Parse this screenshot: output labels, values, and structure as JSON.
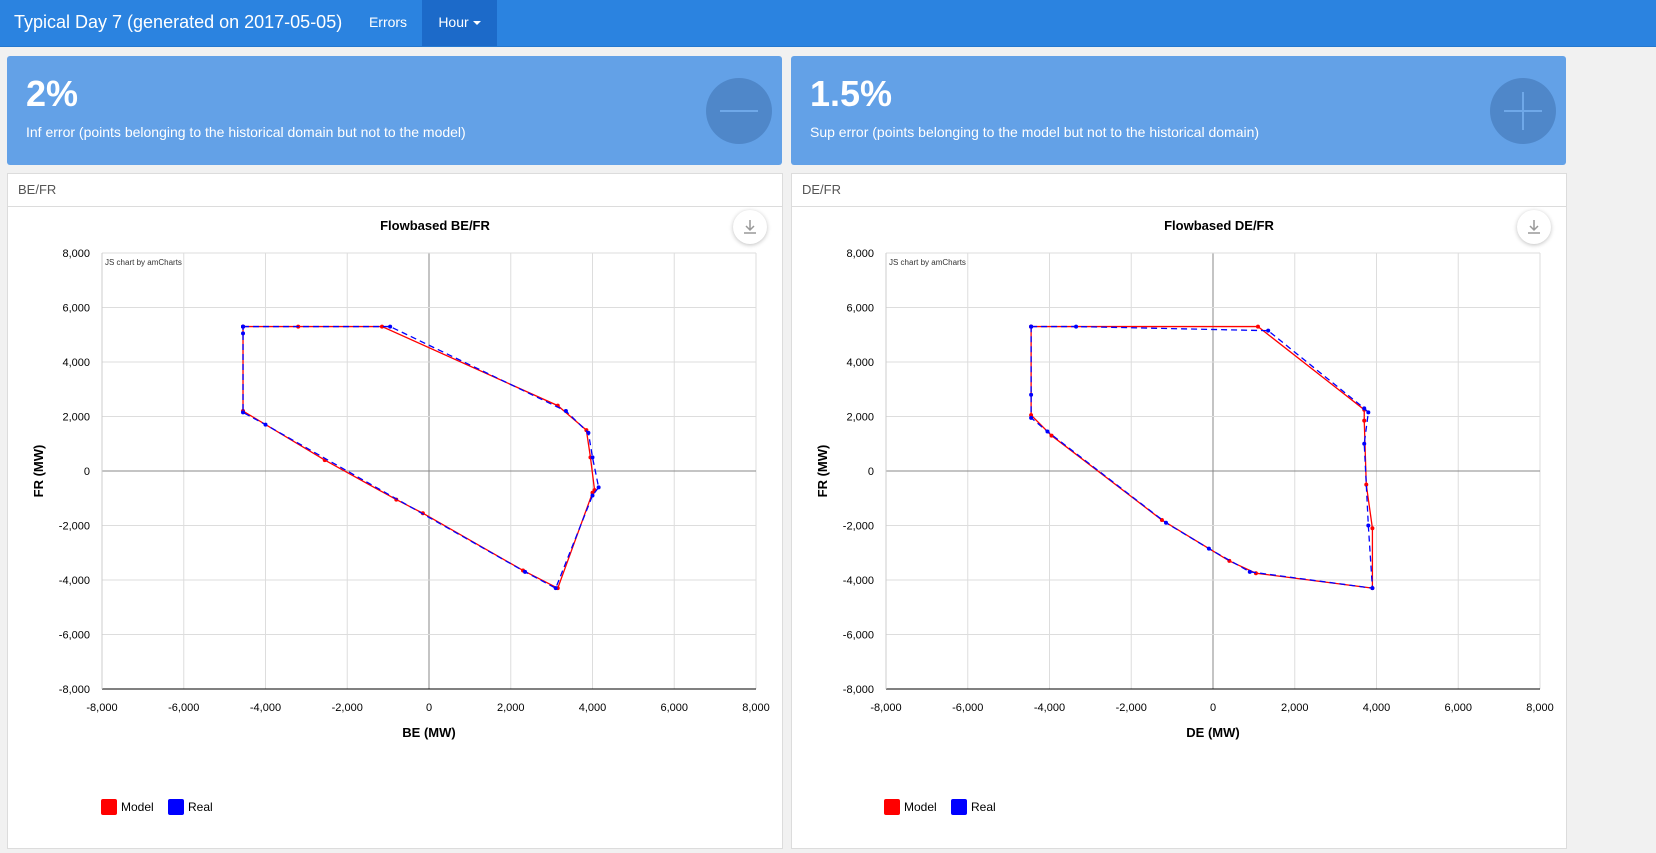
{
  "navbar": {
    "title": "Typical Day 7 (generated on 2017-05-05)",
    "errors_label": "Errors",
    "hour_label": "Hour"
  },
  "stats": [
    {
      "value": "2%",
      "label": "Inf error (points belonging to the historical domain but not to the model)",
      "icon": "minus-icon"
    },
    {
      "value": "1.5%",
      "label": "Sup error (points belonging to the model but not to the historical domain)",
      "icon": "plus-icon"
    }
  ],
  "colors": {
    "navbar": "#2b83e0",
    "stat_bg": "#63a1e7",
    "model": "#ff0000",
    "real": "#0000ff"
  },
  "panels": [
    {
      "heading": "BE/FR"
    },
    {
      "heading": "DE/FR"
    }
  ],
  "chart_data": [
    {
      "type": "scatter",
      "title": "Flowbased BE/FR",
      "credit": "JS chart by amCharts",
      "xlabel": "BE (MW)",
      "ylabel": "FR (MW)",
      "xlim": [
        -8000,
        8000
      ],
      "ylim": [
        -8000,
        8000
      ],
      "xticks": [
        "-8,000",
        "-6,000",
        "-4,000",
        "-2,000",
        "0",
        "2,000",
        "4,000",
        "6,000",
        "8,000"
      ],
      "yticks": [
        "8,000",
        "6,000",
        "4,000",
        "2,000",
        "0",
        "-2,000",
        "-4,000",
        "-6,000",
        "-8,000"
      ],
      "grid": true,
      "legend_position": "bottom-left",
      "series": [
        {
          "name": "Model",
          "color": "#ff0000",
          "dashed": false,
          "x": [
            -4550,
            -3200,
            -1150,
            3150,
            3850,
            3950,
            4050,
            4000,
            3150,
            2300,
            -150,
            -800,
            -2550,
            -4550,
            -4550
          ],
          "y": [
            5300,
            5300,
            5300,
            2400,
            1500,
            500,
            -700,
            -800,
            -4300,
            -3650,
            -1550,
            -1050,
            400,
            2200,
            5300
          ]
        },
        {
          "name": "Real",
          "color": "#0000ff",
          "dashed": true,
          "x": [
            -4550,
            -950,
            3350,
            3900,
            4000,
            4150,
            4000,
            3100,
            2350,
            -4000,
            -4550,
            -4550,
            -4550
          ],
          "y": [
            5300,
            5300,
            2200,
            1400,
            500,
            -600,
            -900,
            -4300,
            -3700,
            1700,
            2150,
            5050,
            5300
          ]
        }
      ]
    },
    {
      "type": "scatter",
      "title": "Flowbased DE/FR",
      "credit": "JS chart by amCharts",
      "xlabel": "DE (MW)",
      "ylabel": "FR (MW)",
      "xlim": [
        -8000,
        8000
      ],
      "ylim": [
        -8000,
        8000
      ],
      "xticks": [
        "-8,000",
        "-6,000",
        "-4,000",
        "-2,000",
        "0",
        "2,000",
        "4,000",
        "6,000",
        "8,000"
      ],
      "yticks": [
        "8,000",
        "6,000",
        "4,000",
        "2,000",
        "0",
        "-2,000",
        "-4,000",
        "-6,000",
        "-8,000"
      ],
      "grid": true,
      "legend_position": "bottom-left",
      "series": [
        {
          "name": "Model",
          "color": "#ff0000",
          "dashed": false,
          "x": [
            -4450,
            1100,
            3700,
            3700,
            3750,
            3900,
            3900,
            1050,
            400,
            -1250,
            -3950,
            -4450,
            -4450
          ],
          "y": [
            5300,
            5300,
            2250,
            1850,
            -500,
            -2100,
            -4300,
            -3750,
            -3300,
            -1800,
            1300,
            2050,
            5300
          ]
        },
        {
          "name": "Real",
          "color": "#0000ff",
          "dashed": true,
          "x": [
            -4450,
            -3350,
            1350,
            3700,
            3800,
            3700,
            3800,
            3900,
            900,
            -100,
            -1150,
            -4050,
            -4450,
            -4450,
            -4450
          ],
          "y": [
            5300,
            5300,
            5150,
            2300,
            2150,
            1000,
            -2000,
            -4300,
            -3700,
            -2850,
            -1900,
            1450,
            1950,
            2800,
            5300
          ]
        }
      ]
    }
  ]
}
